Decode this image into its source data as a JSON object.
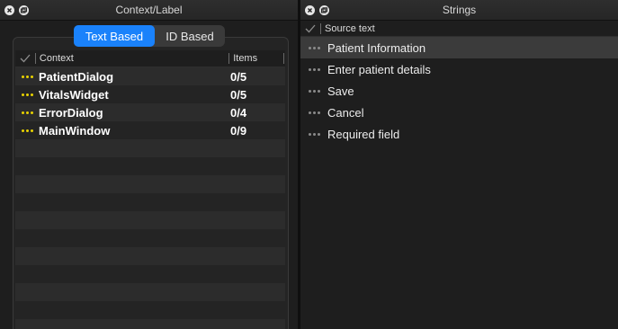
{
  "colors": {
    "accent": "#1a82fb",
    "dots_done": "#e8d200",
    "dots_neutral": "#8a8a8a"
  },
  "left_panel": {
    "title": "Context/Label",
    "close_icon": "close-icon",
    "float_icon": "float-icon",
    "segmented": {
      "options": [
        "Text Based",
        "ID Based"
      ],
      "selected": "Text Based"
    },
    "table": {
      "columns": {
        "context": "Context",
        "items": "Items"
      },
      "rows": [
        {
          "context": "PatientDialog",
          "items": "0/5",
          "status_icon": "dots-icon"
        },
        {
          "context": "VitalsWidget",
          "items": "0/5",
          "status_icon": "dots-icon"
        },
        {
          "context": "ErrorDialog",
          "items": "0/4",
          "status_icon": "dots-icon"
        },
        {
          "context": "MainWindow",
          "items": "0/9",
          "status_icon": "dots-icon"
        }
      ]
    }
  },
  "right_panel": {
    "title": "Strings",
    "close_icon": "close-icon",
    "float_icon": "float-icon",
    "columns": {
      "source": "Source text"
    },
    "rows": [
      {
        "text": "Patient Information",
        "selected": true
      },
      {
        "text": "Enter patient details",
        "selected": false
      },
      {
        "text": "Save",
        "selected": false
      },
      {
        "text": "Cancel",
        "selected": false
      },
      {
        "text": "Required field",
        "selected": false
      }
    ]
  }
}
